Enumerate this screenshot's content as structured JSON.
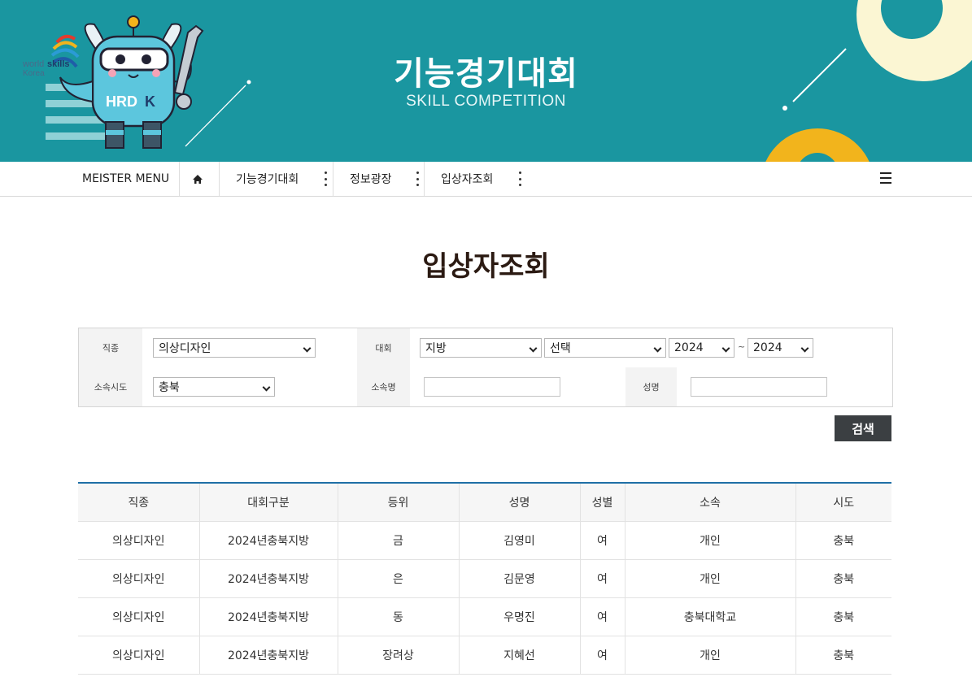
{
  "banner": {
    "title": "기능경기대회",
    "subtitle": "SKILL COMPETITION",
    "logo_text": "worldskills Korea",
    "mascot_badge": "HRDK"
  },
  "nav": {
    "meister_menu": "MEISTER MENU",
    "home_icon": "home-icon",
    "items": [
      {
        "label": "기능경기대회"
      },
      {
        "label": "정보광장"
      },
      {
        "label": "입상자조회"
      }
    ],
    "menu_icon": "hamburger-icon"
  },
  "page": {
    "title": "입상자조회"
  },
  "search": {
    "job_label": "직종",
    "job_value": "의상디자인",
    "contest_label": "대회",
    "contest_type_value": "지방",
    "contest_select_value": "선택",
    "year_from": "2024",
    "year_sep": "~",
    "year_to": "2024",
    "region_label": "소속시도",
    "region_value": "충북",
    "org_label": "소속명",
    "org_value": "",
    "name_label": "성명",
    "name_value": "",
    "button": "검색"
  },
  "table": {
    "headers": [
      "직종",
      "대회구분",
      "등위",
      "성명",
      "성별",
      "소속",
      "시도"
    ],
    "rows": [
      [
        "의상디자인",
        "2024년충북지방",
        "금",
        "김영미",
        "여",
        "개인",
        "충북"
      ],
      [
        "의상디자인",
        "2024년충북지방",
        "은",
        "김문영",
        "여",
        "개인",
        "충북"
      ],
      [
        "의상디자인",
        "2024년충북지방",
        "동",
        "우명진",
        "여",
        "충북대학교",
        "충북"
      ],
      [
        "의상디자인",
        "2024년충북지방",
        "장려상",
        "지혜선",
        "여",
        "개인",
        "충북"
      ]
    ]
  },
  "colors": {
    "banner_bg": "#1a96a0",
    "table_top_border": "#1f6fa6",
    "search_button_bg": "#3b3f42"
  }
}
